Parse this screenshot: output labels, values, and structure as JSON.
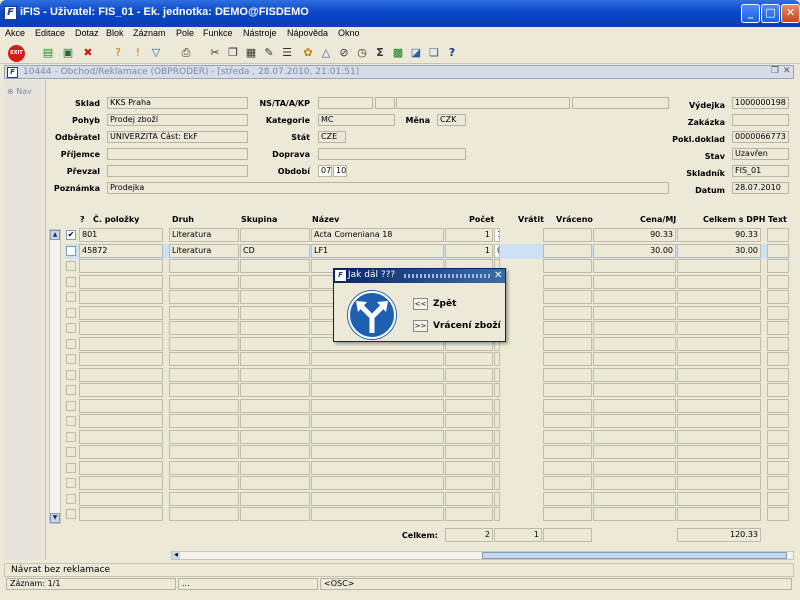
{
  "window": {
    "title": "iFIS - Uživatel: FIS_01 - Ek. jednotka: DEMO@FISDEMO",
    "minimize": "_",
    "maximize": "□",
    "close": "✕"
  },
  "menu": [
    "Akce",
    "Editace",
    "Dotaz",
    "Blok",
    "Záznam",
    "Pole",
    "Funkce",
    "Nástroje",
    "Nápověda",
    "Okno"
  ],
  "toolbar": {
    "exit_label": "EXIT",
    "icons": [
      "insert-record-icon",
      "save-icon",
      "delete-record-icon",
      "enter-query-icon",
      "execute-query-icon",
      "filter-icon",
      "print-icon",
      "cut-icon",
      "copy-icon",
      "paste-icon",
      "edit-field-icon",
      "list-icon",
      "color-icon",
      "settings-icon",
      "calculator-icon",
      "clock-icon",
      "sum-icon",
      "excel-icon",
      "export-icon",
      "help-window-icon",
      "help-icon"
    ]
  },
  "form": {
    "window_title": "10444 - Obchod/Reklamace (OBPRODER) - [středa , 28.07.2010, 21:01:51]",
    "nav_label": "Nav",
    "header": {
      "sklad": {
        "label": "Sklad",
        "value": "KKS Praha"
      },
      "pohyb": {
        "label": "Pohyb",
        "value": "Prodej zboží"
      },
      "odberatel": {
        "label": "Odběratel",
        "value": "UNIVERZITA Část: EkF"
      },
      "prijemce": {
        "label": "Příjemce",
        "value": ""
      },
      "prevzal": {
        "label": "Převzal",
        "value": ""
      },
      "poznamka": {
        "label": "Poznámka",
        "value": "Prodejka"
      },
      "ns": {
        "label": "NS/TA/A/KP",
        "value": ""
      },
      "kategorie": {
        "label": "Kategorie",
        "value": "MC"
      },
      "mena": {
        "label": "Měna",
        "value": "CZK"
      },
      "stat": {
        "label": "Stát",
        "value": "CZE"
      },
      "doprava": {
        "label": "Doprava",
        "value": ""
      },
      "obdobi": {
        "label": "Období",
        "value1": "07",
        "value2": "10"
      },
      "vydejka": {
        "label": "Výdejka",
        "value": "1000000198"
      },
      "zakazka": {
        "label": "Zakázka",
        "value": ""
      },
      "pokl_doklad": {
        "label": "Pokl.doklad",
        "value": "0000066773"
      },
      "stav": {
        "label": "Stav",
        "value": "Uzavřen"
      },
      "skladnik": {
        "label": "Skladník",
        "value": "FIS_01"
      },
      "datum": {
        "label": "Datum",
        "value": "28.07.2010"
      }
    },
    "table": {
      "columns": [
        "?",
        "Č. položky",
        "Druh",
        "Skupina",
        "Název",
        "Počet",
        "Vrátit",
        "Vráceno",
        "Cena/MJ",
        "Celkem s DPH",
        "Text"
      ],
      "rows": [
        {
          "checked": true,
          "cislo": "801",
          "druh": "Literatura",
          "skupina": "",
          "nazev": "Acta Comeniana 18",
          "pocet": "1",
          "vratit": "1",
          "vraceno": "",
          "cena": "90.33",
          "celkem": "90.33",
          "text": ""
        },
        {
          "checked": false,
          "cislo": "45872",
          "druh": "Literatura",
          "skupina": "CD",
          "nazev": "LF1",
          "pocet": "1",
          "vratit": "0",
          "vraceno": "",
          "cena": "30.00",
          "celkem": "30.00",
          "text": ""
        }
      ]
    },
    "totals": {
      "label": "Celkem:",
      "pocet": "2",
      "vratit": "1",
      "vraceno": "",
      "cena": "",
      "celkem": "120.33"
    }
  },
  "dialog": {
    "title": "Jak dál ???",
    "back_button": "<<",
    "back_label": "Zpět",
    "forward_button": ">>",
    "forward_label": "Vrácení zboží"
  },
  "status": {
    "message": "Návrat bez reklamace",
    "record": "Záznam: 1/1",
    "ellipsis": "...",
    "mode": "<OSC>"
  }
}
